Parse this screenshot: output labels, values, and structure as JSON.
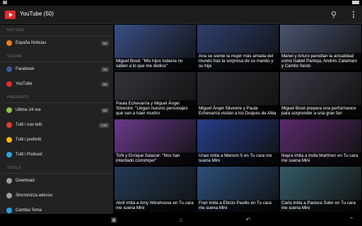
{
  "app": {
    "title": "YouTube (50)"
  },
  "colors": {
    "accent": "#e02b2b",
    "drawer_bg": "#222222",
    "actionbar_bg": "#1d1d1d"
  },
  "icons": {
    "search": "search-icon",
    "overflow": "more-vert-icon"
  },
  "drawer": {
    "sections": [
      {
        "title": "NOTIZIE",
        "items": [
          {
            "label": "España Noticias",
            "badge": "52",
            "icon": "rss-icon",
            "icon_color": "#f07b1d"
          }
        ]
      },
      {
        "title": "SOCIAL",
        "items": [
          {
            "label": "Facebook",
            "badge": "29",
            "icon": "facebook-icon",
            "icon_color": "#3b5998"
          },
          {
            "label": "YouTube",
            "badge": "50",
            "icon": "youtube-icon",
            "icon_color": "#e02b2b"
          }
        ]
      },
      {
        "title": "PREFERITI",
        "items": [
          {
            "label": "Ultime 24 ore",
            "badge": "60",
            "icon": "clock-icon",
            "icon_color": "#8bc34a"
          },
          {
            "label": "Tutti i non letti",
            "badge": "130",
            "icon": "unread-icon",
            "icon_color": "#e53935"
          },
          {
            "label": "Tutti i preferiti",
            "badge": "",
            "icon": "star-icon",
            "icon_color": "#f5b800"
          },
          {
            "label": "Tutti i Podcast",
            "badge": "",
            "icon": "podcast-icon",
            "icon_color": "#29a3e0"
          }
        ]
      },
      {
        "title": "TOOLS",
        "items": [
          {
            "label": "Download",
            "badge": "",
            "icon": "download-icon",
            "icon_color": "#9e9e9e"
          },
          {
            "label": "Sincronizza adesso",
            "badge": "",
            "icon": "sync-icon",
            "icon_color": "#9e9e9e"
          },
          {
            "label": "Cambia Tema",
            "badge": "",
            "icon": "theme-icon",
            "icon_color": "#29a3e0"
          }
        ]
      }
    ]
  },
  "videos": [
    {
      "caption": "Miguel Bosé: \"Mis hijos todavía no saben a lo que me dedico\"",
      "color": "#3a4f86"
    },
    {
      "caption": "Ana se siente la mujer más amada del mundo tras la sorpresa de su marido y su hija",
      "color": "#2e3f6e"
    },
    {
      "caption": "Manel y Arturo parodian la actualidad como Isabel Pantoja, Andrés Calamaro y Camilo Sesto",
      "color": "#4a5470"
    },
    {
      "caption": "Paula Echevarría y Miguel Ángel Silvestre: \"Llegan nuevos personajes que van a traer mucho",
      "color": "#33333b"
    },
    {
      "caption": "Miguel Ángel Silvestre y Paula Echevarría visitan a los Duques de Alba",
      "color": "#2b2a30"
    },
    {
      "caption": "Miguel Bosé prepara una performance para sorprender a una gran fan",
      "color": "#3a3a46"
    },
    {
      "caption": "Toñi y Enrique Salazar: \"Nos han intentado corromper\"",
      "color": "#6a3a8c"
    },
    {
      "caption": "Unax imita a Maroon 5 en Tu cara me suena Mini",
      "color": "#263e8a"
    },
    {
      "caption": "Nayra imita a India Martínez en Tu cara me suena Mini",
      "color": "#5a2a6c"
    },
    {
      "caption": "Abril imita a Amy Winehouse en Tu cara me suena Mini",
      "color": "#233a55"
    },
    {
      "caption": "Fran imita a Efecto Pasillo en Tu cara me suena Mini",
      "color": "#2c4f7a"
    },
    {
      "caption": "Carla imita a Pastora Soler en Tu cara me suena Mini",
      "color": "#345a66"
    }
  ],
  "navbar": {
    "back": "back-icon",
    "home": "home-icon",
    "recents": "recents-icon",
    "keyboard_hide": "chevron-up-icon"
  }
}
